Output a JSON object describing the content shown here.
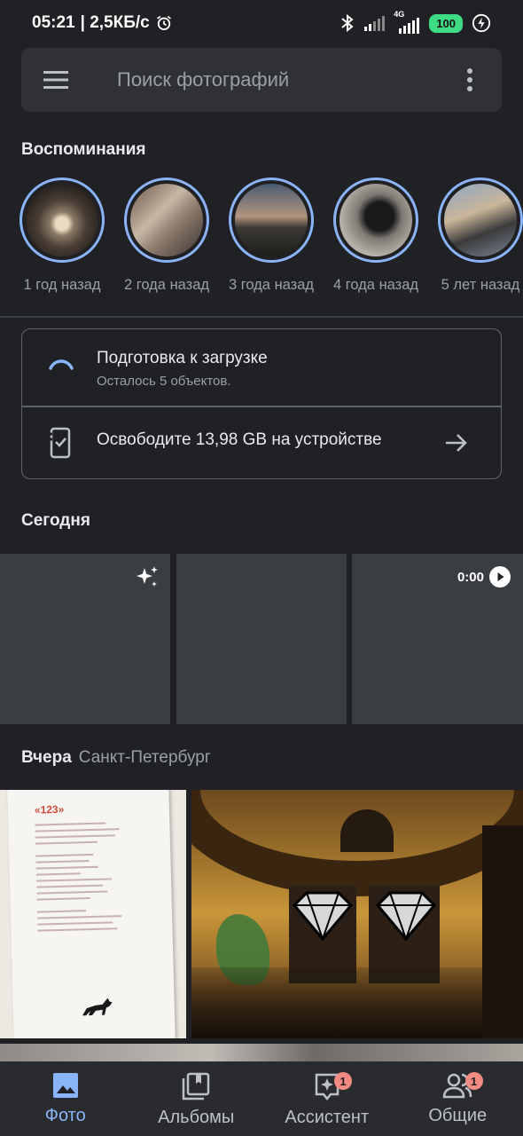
{
  "status_bar": {
    "time": "05:21",
    "speed": "| 2,5КБ/с",
    "network": "4G",
    "battery": "100",
    "icons": [
      "alarm-icon",
      "bluetooth-icon",
      "signal-icon",
      "signal-4g-icon",
      "charging-icon"
    ]
  },
  "search": {
    "placeholder": "Поиск фотографий",
    "menu_icon": "hamburger-menu-icon",
    "more_icon": "more-vertical-icon"
  },
  "memories": {
    "title": "Воспоминания",
    "items": [
      {
        "label": "1 год назад"
      },
      {
        "label": "2 года назад"
      },
      {
        "label": "3 года назад"
      },
      {
        "label": "4 года назад"
      },
      {
        "label": "5 лет назад"
      }
    ]
  },
  "upload_card": {
    "title": "Подготовка к загрузке",
    "subtitle": "Осталось 5 объектов.",
    "free_space": "Освободите 13,98 GB на устройстве",
    "icons": [
      "loading-spinner-icon",
      "phone-cleanup-icon",
      "arrow-right-icon"
    ]
  },
  "today": {
    "title": "Сегодня",
    "video_duration": "0:00",
    "icons": [
      "sparkle-icon",
      "play-icon"
    ]
  },
  "yesterday": {
    "title": "Вчера",
    "place": "Санкт-Петербург",
    "book_heading": "«123»"
  },
  "bottom_nav": {
    "items": [
      {
        "label": "Фото",
        "icon": "photo-icon",
        "badge": ""
      },
      {
        "label": "Альбомы",
        "icon": "albums-icon",
        "badge": ""
      },
      {
        "label": "Ассистент",
        "icon": "assistant-icon",
        "badge": "1"
      },
      {
        "label": "Общие",
        "icon": "people-icon",
        "badge": "1"
      }
    ]
  },
  "colors": {
    "background": "#202124",
    "accent": "#8ab4f8",
    "badge": "#f28b82",
    "battery": "#3ddc84"
  }
}
